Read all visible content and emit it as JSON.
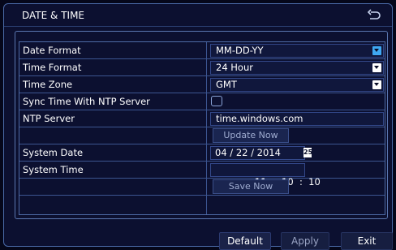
{
  "window": {
    "title": "DATE & TIME",
    "back_icon": "return-arrow-icon"
  },
  "rows": {
    "date_format": {
      "label": "Date Format",
      "value": "MM-DD-YY"
    },
    "time_format": {
      "label": "Time Format",
      "value": "24 Hour"
    },
    "time_zone": {
      "label": "Time Zone",
      "value": "GMT"
    },
    "ntp_sync": {
      "label": "Sync Time With NTP Server",
      "checked": false
    },
    "ntp_server": {
      "label": "NTP Server",
      "value": "time.windows.com"
    },
    "update_now": {
      "label": "Update Now"
    },
    "system_date": {
      "label": "System Date",
      "value": "04 / 22 / 2014",
      "spin_label": "25"
    },
    "system_time": {
      "label": "System Time",
      "value": "11  :  10  :  10"
    },
    "save_now": {
      "label": "Save Now"
    }
  },
  "footer": {
    "default_label": "Default",
    "apply_label": "Apply",
    "exit_label": "Exit"
  },
  "colors": {
    "accent": "#3fa8f2",
    "background": "#0c1030",
    "border": "#4a6aa8"
  }
}
